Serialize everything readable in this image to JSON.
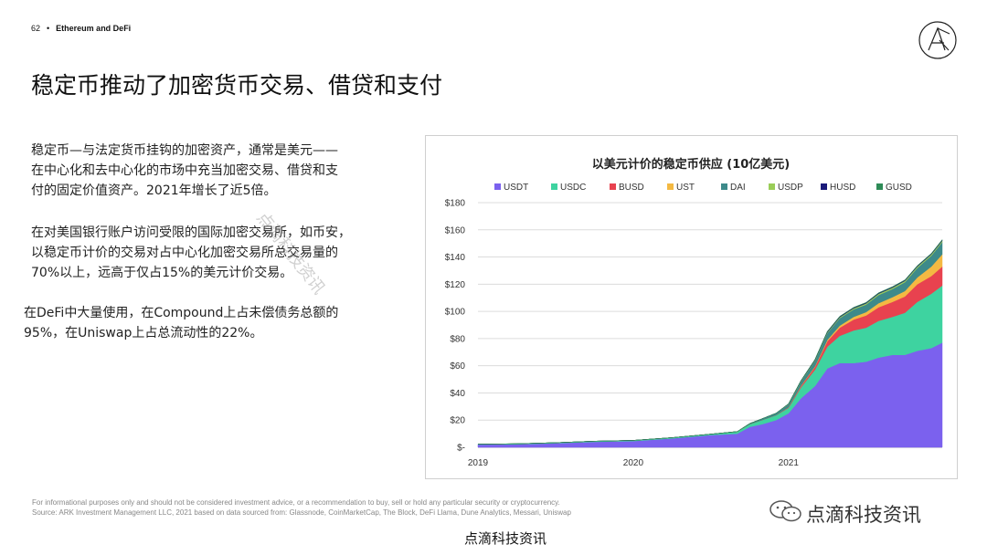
{
  "header": {
    "page_number": "62",
    "section": "Ethereum and DeFi"
  },
  "title": "稳定币推动了加密货币交易、借贷和支付",
  "body": {
    "p1": [
      "稳定币—与法定货币挂钩的加密资产，通常是美元——",
      "在中心化和去中心化的市场中充当加密交易、借贷和支",
      "付的固定价值资产。2021年增长了近5倍。"
    ],
    "p2": [
      "在对美国银行账户访问受限的国际加密交易所，如币安，",
      "以稳定币计价的交易对占中心化加密交易所总交易量的",
      "70%以上，远高于仅占15%的美元计价交易。"
    ],
    "p3": [
      "在DeFi中大量使用，在Compound上占未偿债务总额的",
      "95%，在Uniswap上占总流动性的22%。"
    ]
  },
  "watermark": "点滴科技资讯",
  "footer": {
    "line1": "For informational purposes only and should not be considered investment advice, or a recommendation to buy, sell or hold any particular security or cryptocurrency.",
    "line2": "Source: ARK Investment Management LLC, 2021 based on data sourced from: Glassnode, CoinMarketCap, The Block, DeFi Llama, Dune Analytics, Messari, Uniswap"
  },
  "wechat_mark": "点滴科技资讯",
  "bottom_caption": "点滴科技资讯",
  "chart_data": {
    "type": "area",
    "stacked": true,
    "title": "以美元计价的稳定币供应 (10亿美元)",
    "xlabel": "",
    "ylabel": "",
    "x": [
      2019.0,
      2019.25,
      2019.5,
      2019.75,
      2020.0,
      2020.25,
      2020.5,
      2020.67,
      2020.75,
      2020.83,
      2020.92,
      2021.0,
      2021.08,
      2021.17,
      2021.25,
      2021.33,
      2021.42,
      2021.5,
      2021.58,
      2021.67,
      2021.75,
      2021.83,
      2021.92,
      2021.99
    ],
    "x_ticks": [
      "2019",
      "2020",
      "2021"
    ],
    "x_tick_values": [
      2019,
      2020,
      2021
    ],
    "xlim": [
      2019.0,
      2021.99
    ],
    "ylim": [
      0,
      180
    ],
    "y_ticks": [
      "$-",
      "$20",
      "$40",
      "$60",
      "$80",
      "$100",
      "$120",
      "$140",
      "$160",
      "$180"
    ],
    "y_tick_values": [
      0,
      20,
      40,
      60,
      80,
      100,
      120,
      140,
      160,
      180
    ],
    "grid": true,
    "legend_position": "top",
    "series": [
      {
        "name": "USDT",
        "color": "#7b61ee",
        "values": [
          2,
          2.2,
          3,
          4,
          4.6,
          6.5,
          9,
          10,
          15,
          17,
          20,
          25,
          36,
          45,
          58,
          62,
          62,
          63,
          66,
          68,
          68,
          71,
          73,
          77
        ]
      },
      {
        "name": "USDC",
        "color": "#3ed3a0",
        "values": [
          0.3,
          0.4,
          0.4,
          0.5,
          0.5,
          0.6,
          0.7,
          1.5,
          2,
          3,
          3.5,
          4,
          8,
          12,
          16,
          20,
          24,
          25,
          27,
          28,
          31,
          36,
          40,
          42
        ]
      },
      {
        "name": "BUSD",
        "color": "#e8424f",
        "values": [
          0,
          0,
          0,
          0,
          0,
          0,
          0,
          0,
          0,
          0,
          0.1,
          0.5,
          1,
          2,
          4,
          6,
          8,
          9,
          10,
          11,
          12,
          13,
          13,
          14
        ]
      },
      {
        "name": "UST",
        "color": "#f4b942",
        "values": [
          0,
          0,
          0,
          0,
          0,
          0,
          0,
          0,
          0,
          0,
          0,
          0,
          0.3,
          0.5,
          1,
          1.5,
          2,
          2.5,
          3,
          3.5,
          4,
          5,
          7,
          9
        ]
      },
      {
        "name": "DAI",
        "color": "#3d8a8a",
        "values": [
          0,
          0,
          0,
          0,
          0,
          0,
          0,
          0.1,
          0.5,
          1,
          1.5,
          2,
          3,
          4,
          5,
          5.5,
          5.5,
          5.5,
          6,
          6,
          6.5,
          7,
          8,
          9
        ]
      },
      {
        "name": "USDP",
        "color": "#9acd58",
        "values": [
          0,
          0,
          0,
          0,
          0,
          0,
          0,
          0,
          0,
          0,
          0,
          0.3,
          0.4,
          0.5,
          0.6,
          0.7,
          0.8,
          0.9,
          1,
          1,
          1,
          1,
          1,
          1
        ]
      },
      {
        "name": "HUSD",
        "color": "#1a1a7a",
        "values": [
          0,
          0,
          0,
          0,
          0,
          0,
          0,
          0,
          0,
          0,
          0,
          0.2,
          0.3,
          0.4,
          0.5,
          0.5,
          0.5,
          0.5,
          0.5,
          0.5,
          0.5,
          0.5,
          0.5,
          0.5
        ]
      },
      {
        "name": "GUSD",
        "color": "#2e8b57",
        "values": [
          0,
          0,
          0,
          0,
          0,
          0,
          0,
          0,
          0,
          0,
          0,
          0.1,
          0.1,
          0.2,
          0.2,
          0.2,
          0.2,
          0.2,
          0.2,
          0.2,
          0.2,
          0.2,
          0.2,
          0.3
        ]
      }
    ]
  }
}
